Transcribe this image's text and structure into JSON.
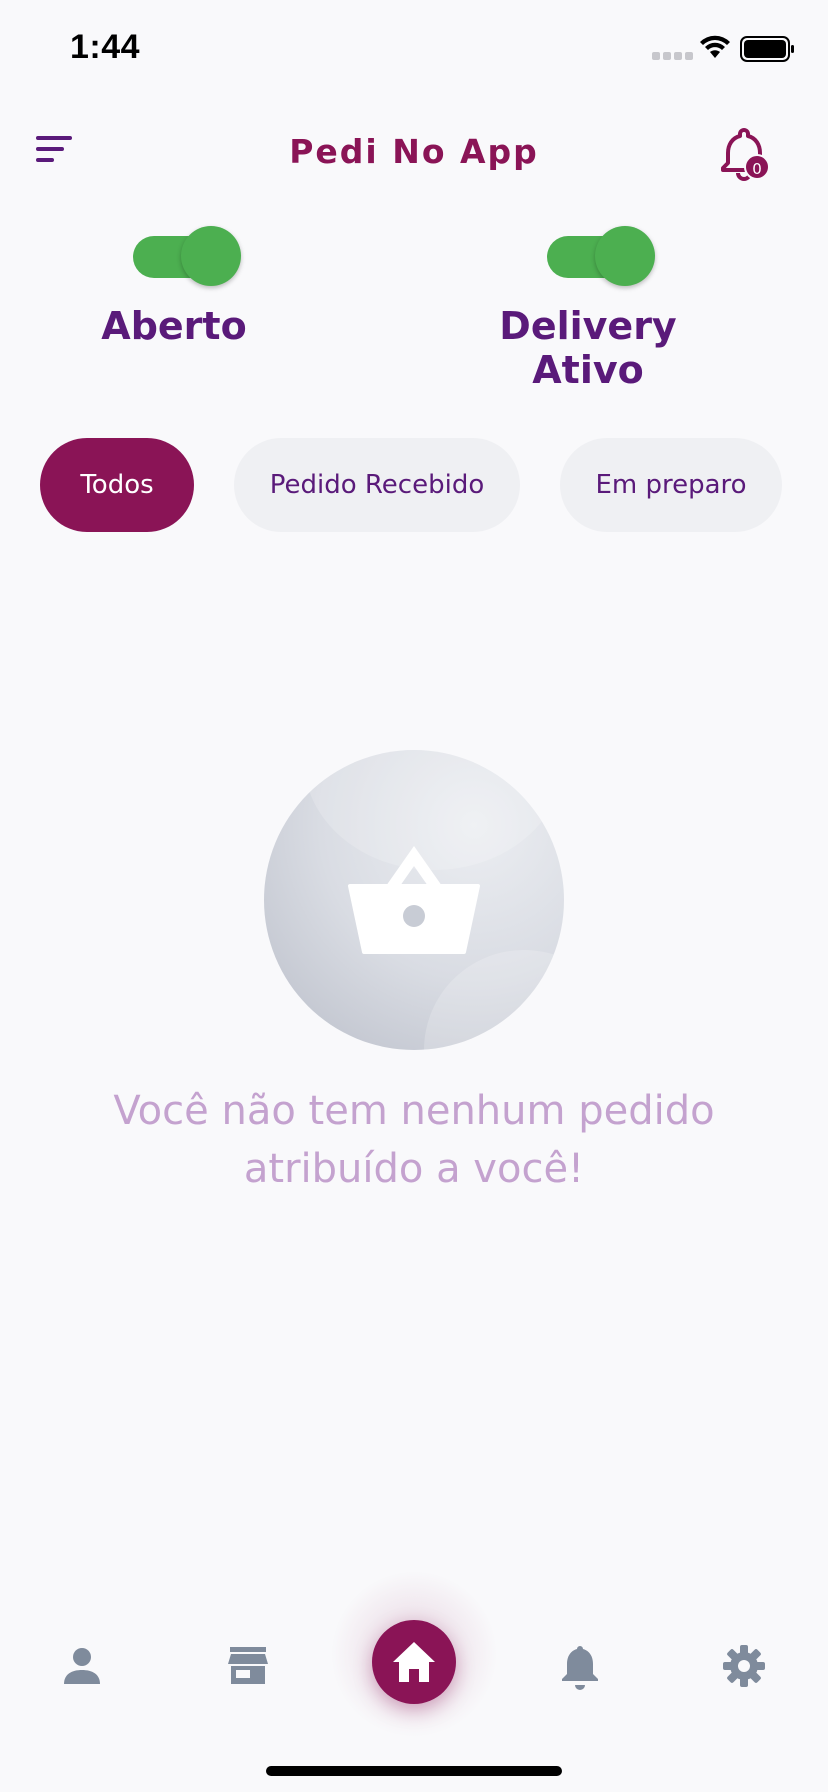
{
  "status_bar": {
    "time": "1:44"
  },
  "header": {
    "title": "Pedi No App",
    "notification_count": "0"
  },
  "toggles": [
    {
      "label": "Aberto",
      "on": true
    },
    {
      "label": "Delivery Ativo",
      "on": true
    }
  ],
  "filter_chips": [
    {
      "label": "Todos",
      "active": true
    },
    {
      "label": "Pedido Recebido",
      "active": false
    },
    {
      "label": "Em preparo",
      "active": false
    }
  ],
  "empty_state": {
    "line1": "Você não tem nenhum pedido",
    "line2": "atribuído a você!",
    "icon": "basket-icon"
  },
  "bottom_nav": {
    "items": [
      "person-icon",
      "store-icon",
      "home-icon",
      "bell-icon",
      "gear-icon"
    ],
    "active": "home-icon"
  },
  "colors": {
    "brand": "#8a1456",
    "heading": "#5a1a7a",
    "toggle_on": "#4caf50",
    "empty_text": "#c4a2cf",
    "nav_icon": "#7f8b9c"
  }
}
